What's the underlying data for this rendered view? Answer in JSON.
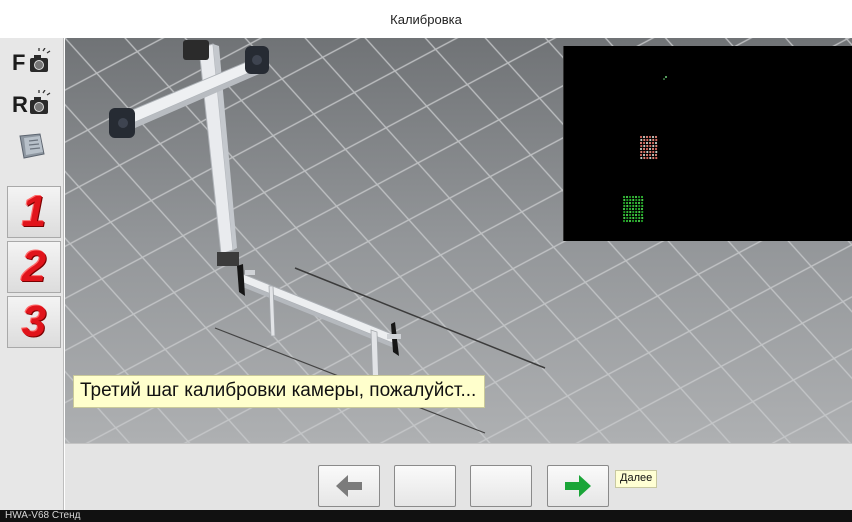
{
  "window": {
    "title": "Калибровка"
  },
  "toolbar": {
    "front_camera_letter": "F",
    "rear_camera_letter": "R",
    "front_camera_icon": "camera-icon",
    "rear_camera_icon": "camera-icon",
    "calibration_icon": "calibration-book-icon",
    "steps": [
      "1",
      "2",
      "3"
    ],
    "step_color": "#e1141b"
  },
  "viewport": {
    "caption": "Третий шаг калибровки камеры, пожалуйст...",
    "preview_background": "#000000"
  },
  "nav": {
    "back_icon": "arrow-left-icon",
    "next_icon": "arrow-right-icon",
    "next_color": "#1aa538",
    "tooltip": "Далее"
  },
  "status": {
    "text": "HWA-V68 Стенд"
  }
}
